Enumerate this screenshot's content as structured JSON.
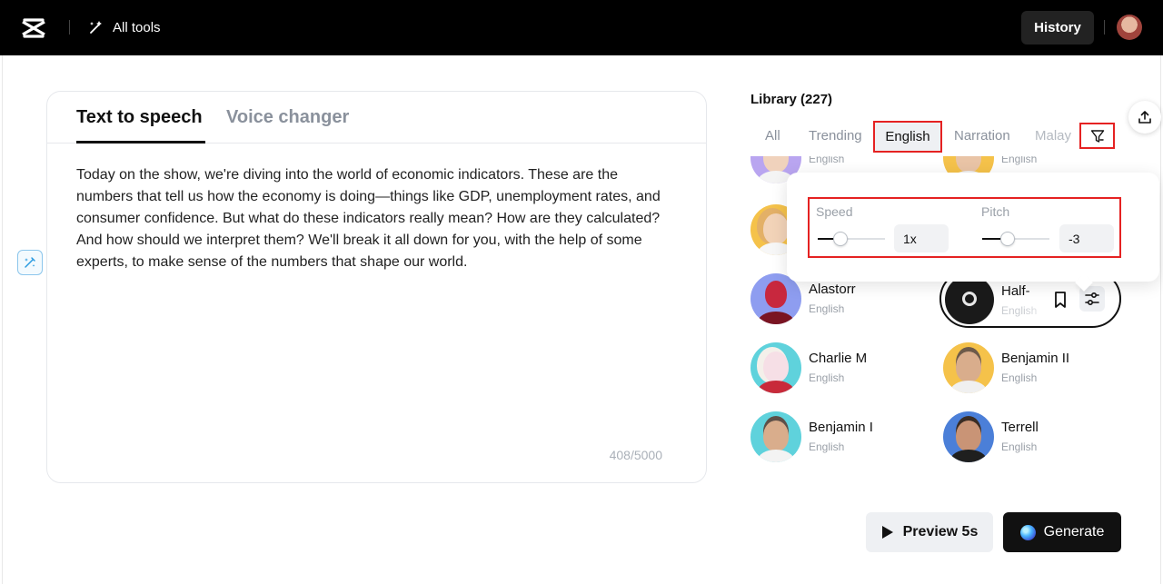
{
  "topbar": {
    "all_tools_label": "All tools",
    "history_label": "History",
    "icons": {
      "logo": "capcut-logo",
      "magic": "magic-wand-icon"
    }
  },
  "editor": {
    "tabs": [
      {
        "label": "Text to speech",
        "active": true
      },
      {
        "label": "Voice changer",
        "active": false
      }
    ],
    "text": "Today on the show, we're diving into the world of economic indicators. These are the numbers that tell us how the economy is doing—things like GDP, unemployment rates, and consumer confidence. But what do these indicators really mean? How are they calculated? And how should we interpret them? We'll break it all down for you, with the help of some experts, to make sense of the numbers that shape our world.",
    "char_count": "408/5000"
  },
  "library": {
    "title": "Library (227)",
    "tabs": [
      "All",
      "Trending",
      "English",
      "Narration",
      "Malay"
    ],
    "active_tab": "English",
    "voices": [
      {
        "name": "",
        "lang": "English"
      },
      {
        "name": "",
        "lang": "English"
      },
      {
        "name": "Alastorr",
        "lang": "English"
      },
      {
        "name": "Half-",
        "lang": "English",
        "selected": true
      },
      {
        "name": "Charlie M",
        "lang": "English"
      },
      {
        "name": "Benjamin II",
        "lang": "English"
      },
      {
        "name": "Benjamin I",
        "lang": "English"
      },
      {
        "name": "Terrell",
        "lang": "English"
      }
    ]
  },
  "popover": {
    "speed_label": "Speed",
    "speed_value": "1x",
    "speed_fraction": 0.3,
    "pitch_label": "Pitch",
    "pitch_value": "-3",
    "pitch_fraction": 0.35
  },
  "actions": {
    "preview_label": "Preview 5s",
    "generate_label": "Generate"
  },
  "colors": {
    "highlight": "#e52222",
    "topbar": "#000000",
    "generate_bg": "#111111"
  }
}
